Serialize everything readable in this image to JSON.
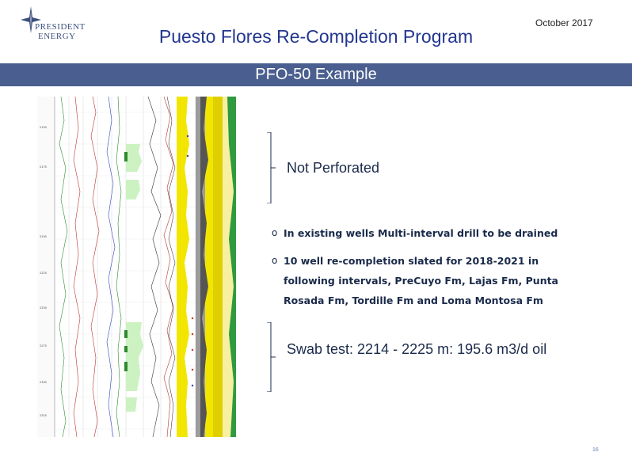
{
  "header": {
    "logo_line1": "PRESIDENT",
    "logo_line2": "ENERGY",
    "date": "October 2017",
    "title": "Puesto Flores Re-Completion Program"
  },
  "banner": {
    "text": "PFO-50 Example"
  },
  "annotations": {
    "upper": "Not Perforated",
    "lower": "Swab test: 2214 - 2225 m:  195.6 m3/d oil"
  },
  "bullets": [
    {
      "marker": "o",
      "text": "In existing wells Multi-interval drill to be drained"
    },
    {
      "marker": "o",
      "text": "10 well re-completion slated for 2018-2021 in following intervals, PreCuyo Fm, Lajas Fm, Punta Rosada Fm, Tordille Fm and Loma Montosa Fm"
    }
  ],
  "footer": {
    "page_number": "16"
  },
  "colors": {
    "title": "#22368f",
    "banner_bg": "#4a5f8f",
    "log_yellow": "#f2e600",
    "log_green": "#ccf2c2",
    "log_grey": "#9c9c9c"
  }
}
